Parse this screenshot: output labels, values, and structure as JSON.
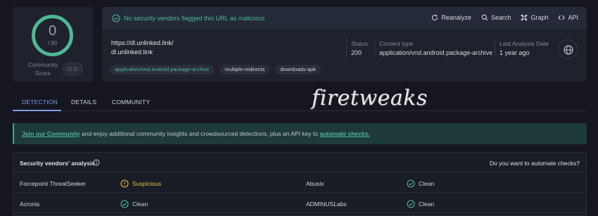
{
  "score": {
    "detections": "0",
    "total": "/ 90",
    "community_label": "Community Score"
  },
  "banner": {
    "message": "No security vendors flagged this URL as malicious"
  },
  "actions": [
    {
      "label": "Reanalyze",
      "icon": "refresh-icon"
    },
    {
      "label": "Search",
      "icon": "search-icon"
    },
    {
      "label": "Graph",
      "icon": "graph-icon"
    },
    {
      "label": "API",
      "icon": "api-icon"
    }
  ],
  "url": {
    "full": "https://dl.unlinked.link/",
    "domain": "dl.unlinked.link"
  },
  "meta": {
    "status_label": "Status",
    "status_value": "200",
    "content_type_label": "Content type",
    "content_type_value": "application/vnd.android.package-archive",
    "last_analysis_label": "Last Analysis Date",
    "last_analysis_value": "1 year ago"
  },
  "tags": [
    "application/vnd.android.package-archive",
    "multiple-redirects",
    "downloads-apk"
  ],
  "tabs": [
    "DETECTION",
    "DETAILS",
    "COMMUNITY"
  ],
  "watermark": "firetweaks",
  "join": {
    "link1": "Join our Community",
    "middle": " and enjoy additional community insights and crowdsourced detections, plus an API key to ",
    "link2": "automate checks."
  },
  "vendors": {
    "title": "Security vendors' analysis",
    "automate": "Do you want to automate checks?",
    "rows": [
      {
        "left_name": "Forcepoint ThreatSeeker",
        "left_result": "Suspicious",
        "right_name": "Abusix",
        "right_result": "Clean"
      },
      {
        "left_name": "Acronis",
        "left_result": "Clean",
        "right_name": "ADMINUSLabs",
        "right_result": "Clean"
      }
    ]
  },
  "colors": {
    "accent_green": "#4eb894",
    "accent_blue": "#7f9ee8",
    "suspicious": "#e3c14a"
  }
}
